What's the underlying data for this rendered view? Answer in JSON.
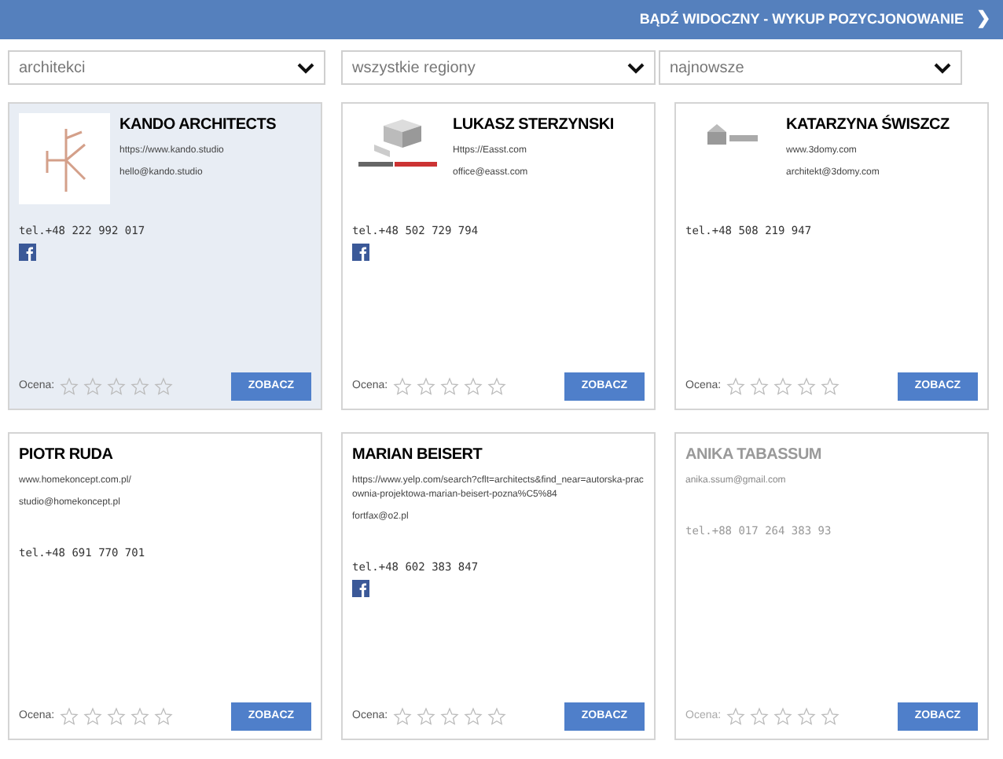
{
  "banner": {
    "text": "BĄDŹ WIDOCZNY - WYKUP POZYCJONOWANIE",
    "arrow": "❯"
  },
  "filters": [
    {
      "value": "architekci"
    },
    {
      "value": "wszystkie regiony"
    },
    {
      "value": "najnowsze"
    }
  ],
  "cards": [
    {
      "name": "KANDO ARCHITECTS",
      "selected": true,
      "inactive": false,
      "has_logo": true,
      "links": [
        "https://www.kando.studio",
        "hello@kando.studio"
      ],
      "phone": "tel.+48 222 992 017",
      "facebook": true,
      "rating_label": "Ocena:",
      "stars": 0,
      "button": "ZOBACZ"
    },
    {
      "name": "LUKASZ STERZYNSKI",
      "selected": false,
      "inactive": false,
      "has_logo": true,
      "links": [
        "Https://Easst.com",
        "office@easst.com"
      ],
      "phone": "tel.+48 502 729 794",
      "facebook": true,
      "rating_label": "Ocena:",
      "stars": 0,
      "button": "ZOBACZ"
    },
    {
      "name": "KATARZYNA ŚWISZCZ",
      "selected": false,
      "inactive": false,
      "has_logo": true,
      "links": [
        "www.3domy.com",
        "architekt@3domy.com"
      ],
      "phone": "tel.+48 508 219 947",
      "facebook": false,
      "rating_label": "Ocena:",
      "stars": 0,
      "button": "ZOBACZ"
    },
    {
      "name": "PIOTR RUDA",
      "selected": false,
      "inactive": false,
      "has_logo": false,
      "links": [
        "www.homekoncept.com.pl/",
        "studio@homekoncept.pl"
      ],
      "phone": "tel.+48 691 770 701",
      "facebook": false,
      "rating_label": "Ocena:",
      "stars": 0,
      "button": "ZOBACZ"
    },
    {
      "name": "MARIAN BEISERT",
      "selected": false,
      "inactive": false,
      "has_logo": false,
      "links": [
        "https://www.yelp.com/search?cflt=architects&find_near=autorska-pracownia-projektowa-marian-beisert-pozna%C5%84",
        "fortfax@o2.pl"
      ],
      "phone": "tel.+48 602 383 847",
      "facebook": true,
      "rating_label": "Ocena:",
      "stars": 0,
      "button": "ZOBACZ"
    },
    {
      "name": "ANIKA TABASSUM",
      "selected": false,
      "inactive": true,
      "has_logo": false,
      "links": [
        "anika.ssum@gmail.com"
      ],
      "phone": "tel.+88 017 264 383 93",
      "facebook": false,
      "rating_label": "Ocena:",
      "stars": 0,
      "button": "ZOBACZ"
    }
  ]
}
